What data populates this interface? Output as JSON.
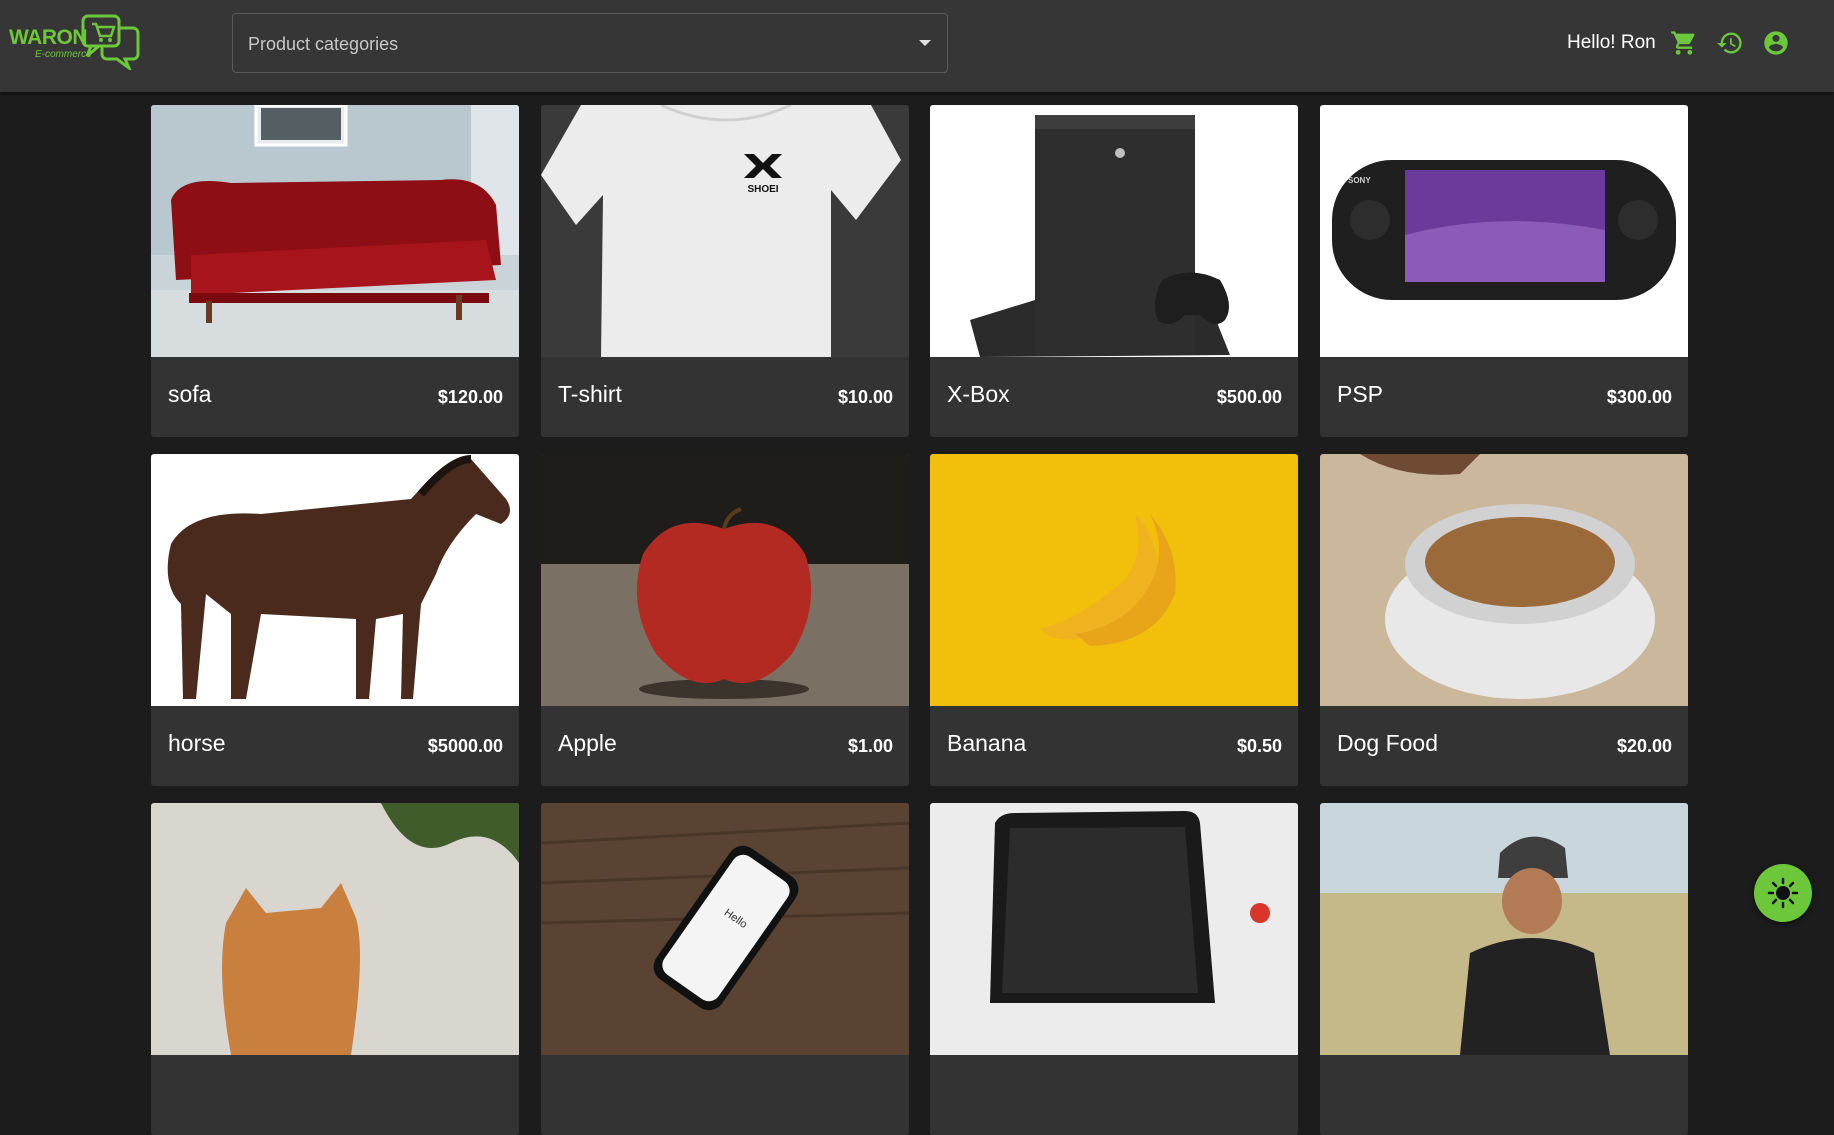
{
  "brand": {
    "name": "WARON",
    "tagline": "E-commerce",
    "accent_color": "#6cc83a"
  },
  "header": {
    "category_select": {
      "placeholder": "Product categories",
      "icon": "chevron-down-icon"
    },
    "greeting": "Hello! Ron",
    "icons": [
      "cart-icon",
      "history-icon",
      "account-icon"
    ]
  },
  "products": [
    {
      "name": "sofa",
      "price": "$120.00",
      "image": "sofa"
    },
    {
      "name": "T-shirt",
      "price": "$10.00",
      "image": "t-shirt",
      "print": "SHOEI"
    },
    {
      "name": "X-Box",
      "price": "$500.00",
      "image": "xbox"
    },
    {
      "name": "PSP",
      "price": "$300.00",
      "image": "psp",
      "print": "SONY"
    },
    {
      "name": "horse",
      "price": "$5000.00",
      "image": "horse"
    },
    {
      "name": "Apple",
      "price": "$1.00",
      "image": "apple"
    },
    {
      "name": "Banana",
      "price": "$0.50",
      "image": "banana"
    },
    {
      "name": "Dog Food",
      "price": "$20.00",
      "image": "dog-food"
    },
    {
      "image": "cat"
    },
    {
      "image": "phone",
      "print": "Hello"
    },
    {
      "image": "laptop"
    },
    {
      "image": "man-with-beanie"
    }
  ],
  "theme_toggle": {
    "icon": "sun-icon"
  }
}
